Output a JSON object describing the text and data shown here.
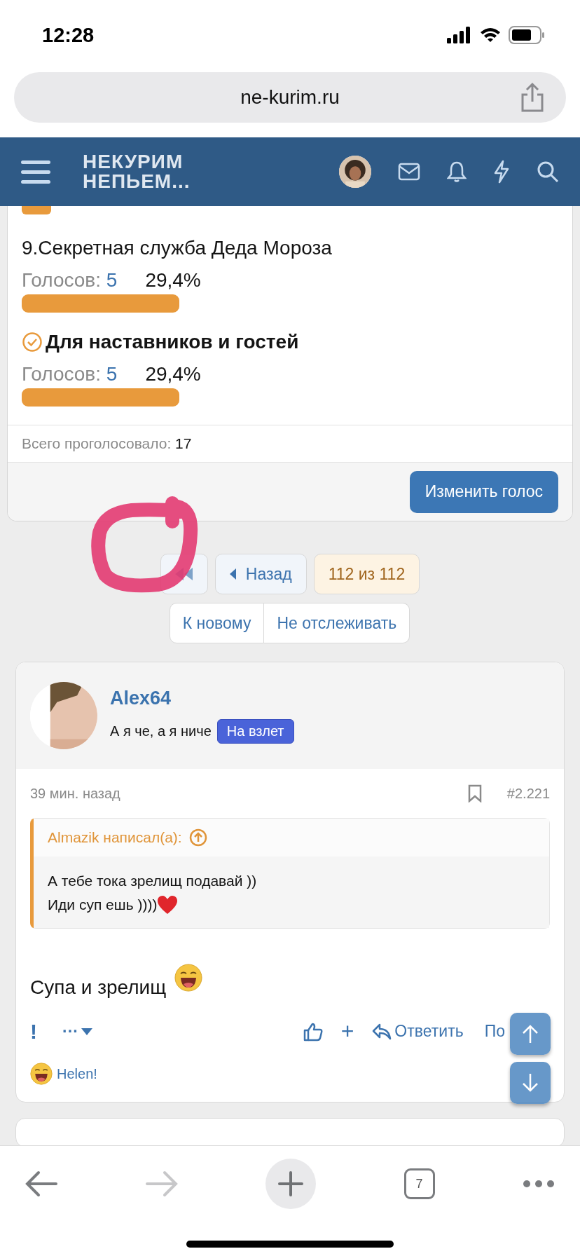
{
  "status_bar": {
    "time": "12:28"
  },
  "browser": {
    "url": "ne-kurim.ru"
  },
  "site_header": {
    "logo_lines": [
      "НЕКУРИМ",
      "НЕПЬЕМ..."
    ]
  },
  "poll": {
    "items": [
      {
        "title": "9.Секретная служба Деда Мороза",
        "voted": false,
        "votes_label": "Голосов:",
        "votes": "5",
        "percent": "29,4%"
      },
      {
        "title": "Для наставников и гостей",
        "voted": true,
        "votes_label": "Голосов:",
        "votes": "5",
        "percent": "29,4%"
      }
    ],
    "total_label": "Всего проголосовало:",
    "total": "17",
    "change_button": "Изменить голос"
  },
  "pagination": {
    "buttons": [
      {
        "kind": "first"
      },
      {
        "kind": "prev",
        "label": "Назад"
      },
      {
        "kind": "page",
        "label": "112 из 112"
      }
    ],
    "links": [
      "К новому",
      "Не отслеживать"
    ]
  },
  "post": {
    "author": "Alex64",
    "user_title": "А я че, а я ниче",
    "badge": "На взлет",
    "time": "39 мин. назад",
    "number": "#2.221",
    "quote": {
      "author": "Almazik написал(а):",
      "lines": [
        "А тебе тока зрелищ подавай ))",
        "Иди суп ешь ))))"
      ]
    },
    "body": "Супа и зрелищ",
    "actions": [
      {
        "kind": "report",
        "label": "!"
      },
      {
        "kind": "more",
        "label": "···"
      },
      {
        "kind": "like"
      },
      {
        "kind": "add",
        "label": "+"
      },
      {
        "kind": "reply",
        "label": "Ответить"
      },
      {
        "kind": "link",
        "label": "По"
      }
    ],
    "reaction": "Helen!"
  },
  "toolbar": {
    "buttons": [
      {
        "kind": "back",
        "disabled": false
      },
      {
        "kind": "forward",
        "disabled": true
      },
      {
        "kind": "new"
      },
      {
        "kind": "tabs",
        "label": "7"
      },
      {
        "kind": "more"
      }
    ]
  }
}
